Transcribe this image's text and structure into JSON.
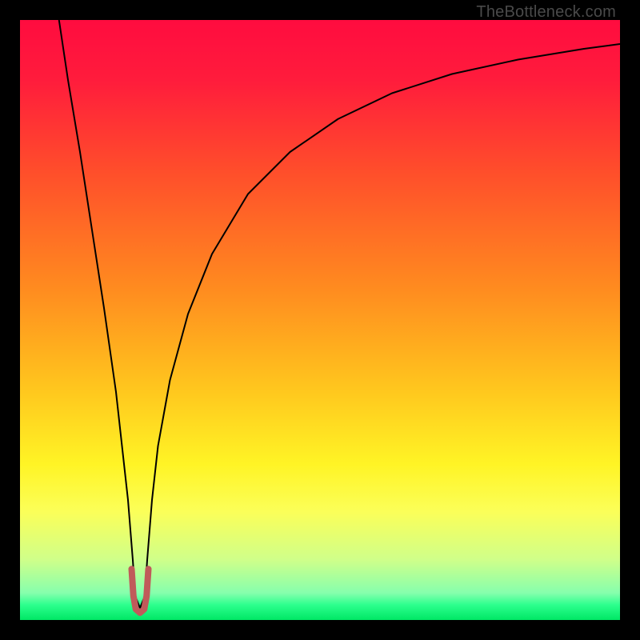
{
  "watermark": "TheBottleneck.com",
  "chart_data": {
    "type": "line",
    "title": "",
    "xlabel": "",
    "ylabel": "",
    "xlim": [
      0,
      100
    ],
    "ylim": [
      0,
      100
    ],
    "gradient_stops": [
      {
        "pos": 0.0,
        "color": "#ff0c3f"
      },
      {
        "pos": 0.1,
        "color": "#ff1c3c"
      },
      {
        "pos": 0.25,
        "color": "#ff4d2b"
      },
      {
        "pos": 0.45,
        "color": "#ff8c1f"
      },
      {
        "pos": 0.62,
        "color": "#ffc81e"
      },
      {
        "pos": 0.74,
        "color": "#fff425"
      },
      {
        "pos": 0.82,
        "color": "#fbff59"
      },
      {
        "pos": 0.9,
        "color": "#cfff8a"
      },
      {
        "pos": 0.955,
        "color": "#86ffad"
      },
      {
        "pos": 0.975,
        "color": "#2cff8d"
      },
      {
        "pos": 1.0,
        "color": "#00e765"
      }
    ],
    "series": [
      {
        "name": "bottleneck-curve",
        "color": "#000000",
        "width": 2,
        "x": [
          6.5,
          8,
          10,
          12,
          14,
          16,
          17,
          18,
          18.8,
          19.2,
          20,
          20.8,
          21.2,
          22,
          23,
          25,
          28,
          32,
          38,
          45,
          53,
          62,
          72,
          83,
          94,
          100
        ],
        "y": [
          100,
          90,
          78,
          65,
          52,
          38,
          29,
          20,
          10,
          4,
          2,
          4,
          10,
          20,
          29,
          40,
          51,
          61,
          71,
          78,
          83.5,
          87.8,
          91,
          93.4,
          95.2,
          96
        ]
      },
      {
        "name": "highlight-tip",
        "color": "#c05a5a",
        "width": 8,
        "cap": "round",
        "x": [
          18.6,
          18.9,
          19.3,
          20.0,
          20.7,
          21.1,
          21.4
        ],
        "y": [
          8.5,
          4.0,
          1.8,
          1.2,
          1.8,
          4.0,
          8.5
        ]
      }
    ],
    "annotations": []
  }
}
